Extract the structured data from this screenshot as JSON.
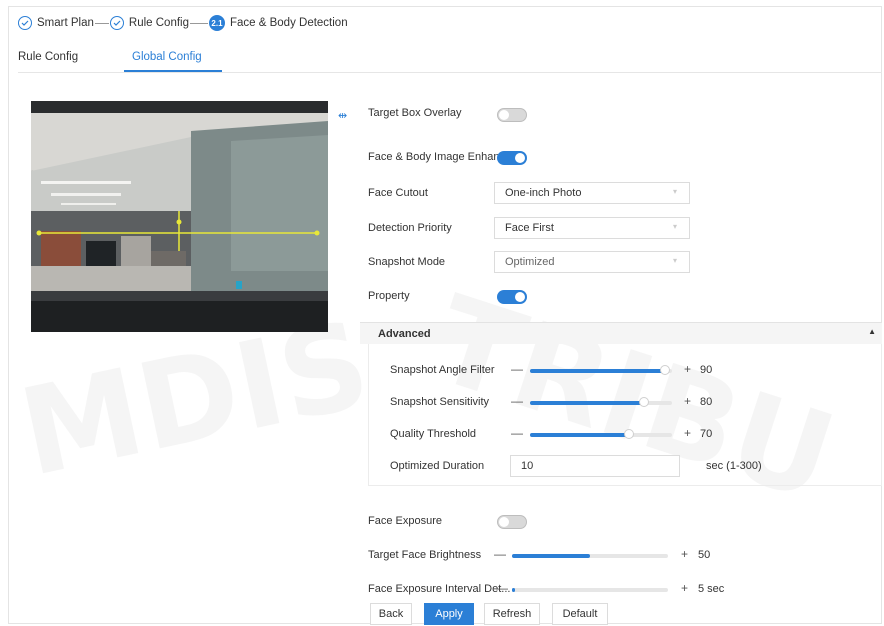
{
  "steps": [
    {
      "label": "Smart Plan",
      "state": "done"
    },
    {
      "label": "Rule Config",
      "state": "done"
    },
    {
      "label": "Face & Body Detection",
      "state": "current",
      "number": "2.1"
    }
  ],
  "tabs": [
    {
      "label": "Rule Config",
      "active": false
    },
    {
      "label": "Global Config",
      "active": true
    }
  ],
  "settings": {
    "target_box_overlay": {
      "label": "Target Box Overlay",
      "on": false
    },
    "image_enhance": {
      "label": "Face & Body Image Enhan...",
      "on": true
    },
    "face_cutout": {
      "label": "Face Cutout",
      "value": "One-inch Photo"
    },
    "detection_priority": {
      "label": "Detection Priority",
      "value": "Face First"
    },
    "snapshot_mode": {
      "label": "Snapshot Mode",
      "value": "Optimized"
    },
    "property": {
      "label": "Property",
      "on": true
    }
  },
  "advanced": {
    "title": "Advanced",
    "angle_filter": {
      "label": "Snapshot Angle Filter",
      "value": "90",
      "level": 0.95
    },
    "sensitivity": {
      "label": "Snapshot Sensitivity",
      "value": "80",
      "level": 0.8
    },
    "quality": {
      "label": "Quality Threshold",
      "value": "70",
      "level": 0.7
    },
    "duration": {
      "label": "Optimized Duration",
      "value": "10",
      "unit": "sec (1-300)"
    }
  },
  "exposure": {
    "face_exposure": {
      "label": "Face Exposure",
      "on": false
    },
    "brightness": {
      "label": "Target Face Brightness",
      "value": "50",
      "level": 0.5
    },
    "interval": {
      "label": "Face Exposure Interval Det...",
      "value": "5 sec",
      "level": 0.02
    }
  },
  "buttons": {
    "back": "Back",
    "apply": "Apply",
    "refresh": "Refresh",
    "default": "Default"
  },
  "slider_signs": {
    "minus": "—",
    "plus": "+"
  },
  "colors": {
    "accent": "#2b7fd6",
    "track": "#e6e6e6"
  },
  "icons": {
    "step_done": "check-circle-icon",
    "collapse": "caret-up-icon",
    "expand": "split-handle-icon"
  }
}
